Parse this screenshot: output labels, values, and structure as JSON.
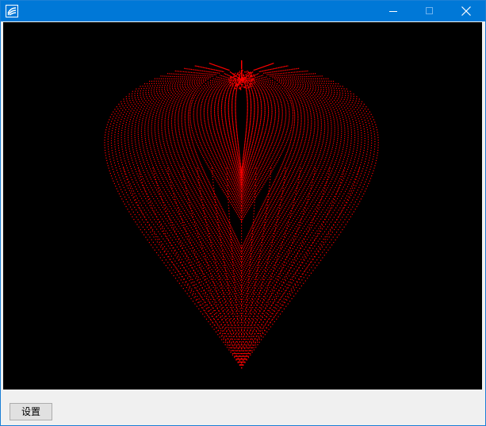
{
  "window": {
    "title": ""
  },
  "canvas": {
    "background": "#000000",
    "point_color": "#ff0000"
  },
  "toolbar": {
    "settings_label": "设置"
  },
  "icons": {
    "app": "app-logo-icon",
    "minimize": "minimize-icon",
    "maximize": "maximize-icon",
    "close": "close-icon"
  }
}
